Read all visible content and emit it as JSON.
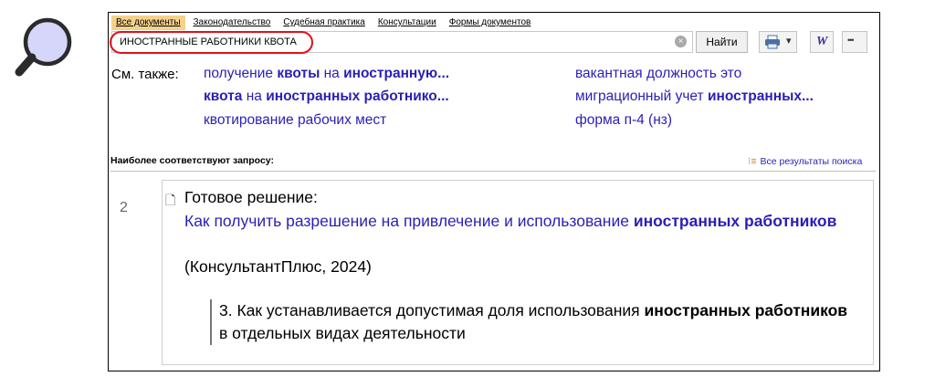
{
  "tabs": [
    "Все документы",
    "Законодательство",
    "Судебная практика",
    "Консультации",
    "Формы документов"
  ],
  "search": {
    "value": "ИНОСТРАННЫЕ РАБОТНИКИ КВОТА",
    "clear_symbol": "×"
  },
  "find_label": "Найти",
  "toolbar": {
    "word_label": "W",
    "more_label": "•••",
    "dropdown_symbol": "▾"
  },
  "see_also": {
    "label": "См. также:",
    "items": [
      {
        "pre": "получение ",
        "b1": "квоты",
        "mid": " на ",
        "b2": "иностранную...",
        "post": ""
      },
      {
        "pre": "",
        "b1": "квота",
        "mid": " на ",
        "b2": "иностранных работнико...",
        "post": ""
      },
      {
        "pre": "квотирование рабочих мест",
        "b1": "",
        "mid": "",
        "b2": "",
        "post": ""
      },
      {
        "pre": "вакантная должность это",
        "b1": "",
        "mid": "",
        "b2": "",
        "post": ""
      },
      {
        "pre": "миграционный учет ",
        "b1": "иностранных...",
        "mid": "",
        "b2": "",
        "post": ""
      },
      {
        "pre": "форма п-4 (нз)",
        "b1": "",
        "mid": "",
        "b2": "",
        "post": ""
      }
    ]
  },
  "best_label": "Наиболее соответствуют запросу:",
  "all_results": {
    "icon": "⁝≡",
    "label": "Все результаты поиска"
  },
  "result": {
    "number": "2",
    "doc_icon": "🗋",
    "type": "Готовое решение:",
    "link_pre": "Как получить разрешение на привлечение и использование ",
    "link_bold": "иностранных работников",
    "source": "(КонсультантПлюс, 2024)",
    "quote_pre": "3. Как устанавливается допустимая доля использования ",
    "quote_bold": "иностранных работников",
    "quote_post": " в отдельных видах деятельности"
  }
}
